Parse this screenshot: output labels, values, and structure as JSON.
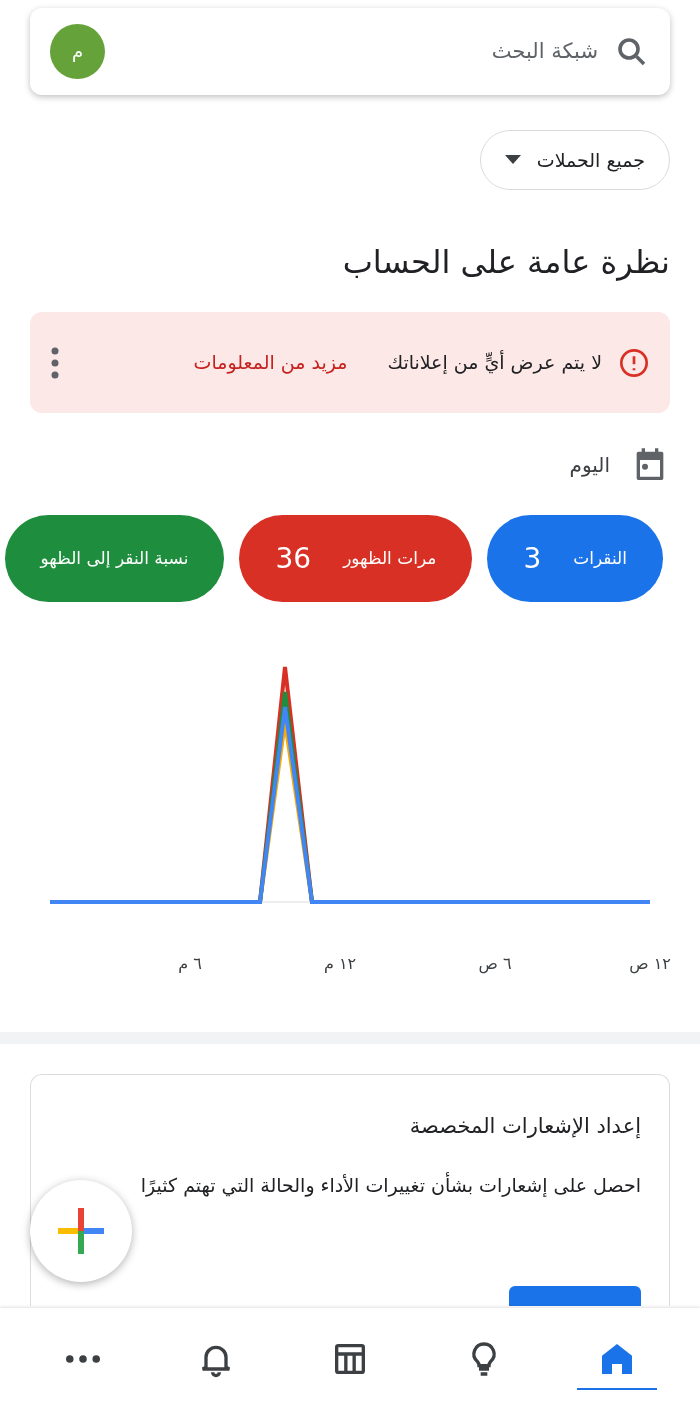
{
  "search": {
    "placeholder": "شبكة البحث",
    "avatar": "م"
  },
  "campaign_filter": {
    "label": "جميع الحملات"
  },
  "title": "نظرة عامة على الحساب",
  "alert": {
    "message": "لا يتم عرض أيٍّ من إعلاناتك",
    "link": "مزيد من المعلومات"
  },
  "date_range": {
    "label": "اليوم"
  },
  "metrics": [
    {
      "label": "النقرات",
      "value": "3",
      "color": "#1a73e8"
    },
    {
      "label": "مرات الظهور",
      "value": "36",
      "color": "#d93025"
    },
    {
      "label": "نسبة النقر إلى الظهو",
      "color": "#1e8e3e"
    }
  ],
  "chart": {
    "x_labels": [
      "١٢ ص",
      "٦ ص",
      "١٢ م",
      "٦ م"
    ]
  },
  "notifications_card": {
    "title": "إعداد الإشعارات المخصصة",
    "body": "احصل على إشعارات بشأن تغييرات الأداء والحالة التي تهتم كثيرًا"
  },
  "bottom_nav": [
    {
      "kind": "home",
      "selected": true
    },
    {
      "kind": "insights",
      "selected": false
    },
    {
      "kind": "table",
      "selected": false
    },
    {
      "kind": "alerts",
      "selected": false
    },
    {
      "kind": "more",
      "selected": false
    }
  ]
}
